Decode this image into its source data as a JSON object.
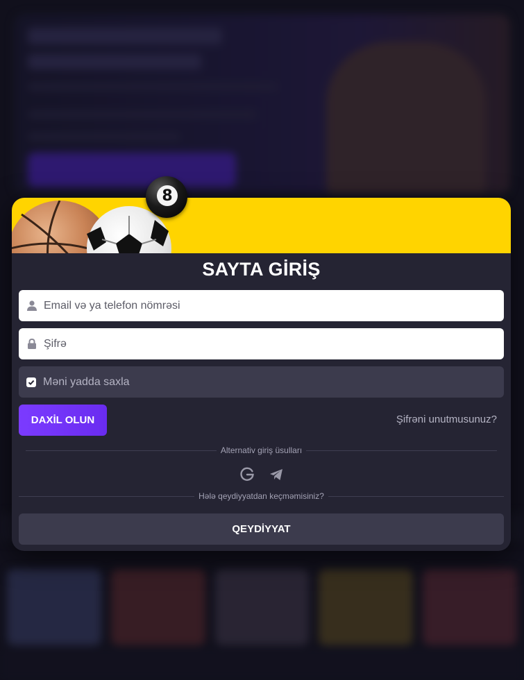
{
  "modal": {
    "title": "SAYTA GİRİŞ",
    "eight_ball_number": "8",
    "email": {
      "placeholder": "Email və ya telefon nömrəsi",
      "value": "",
      "icon": "user-icon"
    },
    "password": {
      "placeholder": "Şifrə",
      "value": "",
      "icon": "lock-icon"
    },
    "remember": {
      "label": "Məni yadda saxla",
      "checked": true
    },
    "login_button": "DAXİL OLUN",
    "forgot_link": "Şifrəni unutmusunuz?",
    "alt_login_label": "Alternativ giriş üsulları",
    "social_icons": [
      "google-icon",
      "telegram-icon"
    ],
    "not_registered_label": "Hələ qeydiyyatdan keçməmisiniz?",
    "register_button": "QEYDİYYAT"
  },
  "colors": {
    "banner": "#ffd400",
    "modal_bg": "#252433",
    "primary_button": "#7b3bff",
    "secondary_button": "#3c3b4d"
  }
}
